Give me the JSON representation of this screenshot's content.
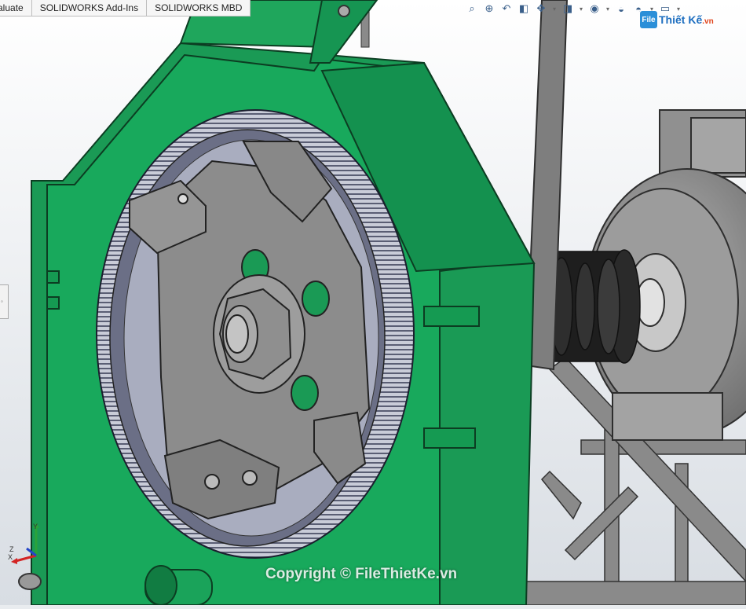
{
  "tabs": [
    {
      "label": "aluate"
    },
    {
      "label": "SOLIDWORKS Add-Ins"
    },
    {
      "label": "SOLIDWORKS MBD"
    }
  ],
  "headsup_icons": [
    "zoom-to-fit-icon",
    "zoom-area-icon",
    "previous-view-icon",
    "section-view-icon",
    "view-orientation-icon",
    "display-style-icon",
    "hide-show-icon",
    "appearance-icon",
    "scene-icon",
    "display-icon"
  ],
  "logo": {
    "brand": "File",
    "name": "Thiết Kế",
    "tld": ".vn"
  },
  "watermark": "Copyright © FileThietKe.vn",
  "triad": {
    "x_label": "X",
    "y_label": "Y",
    "z_label": "Z"
  },
  "colors": {
    "housing": "#1a9a55",
    "rotor": "#8c8c8c",
    "motor": "#9a9a9a",
    "background": "#e9ecef"
  }
}
